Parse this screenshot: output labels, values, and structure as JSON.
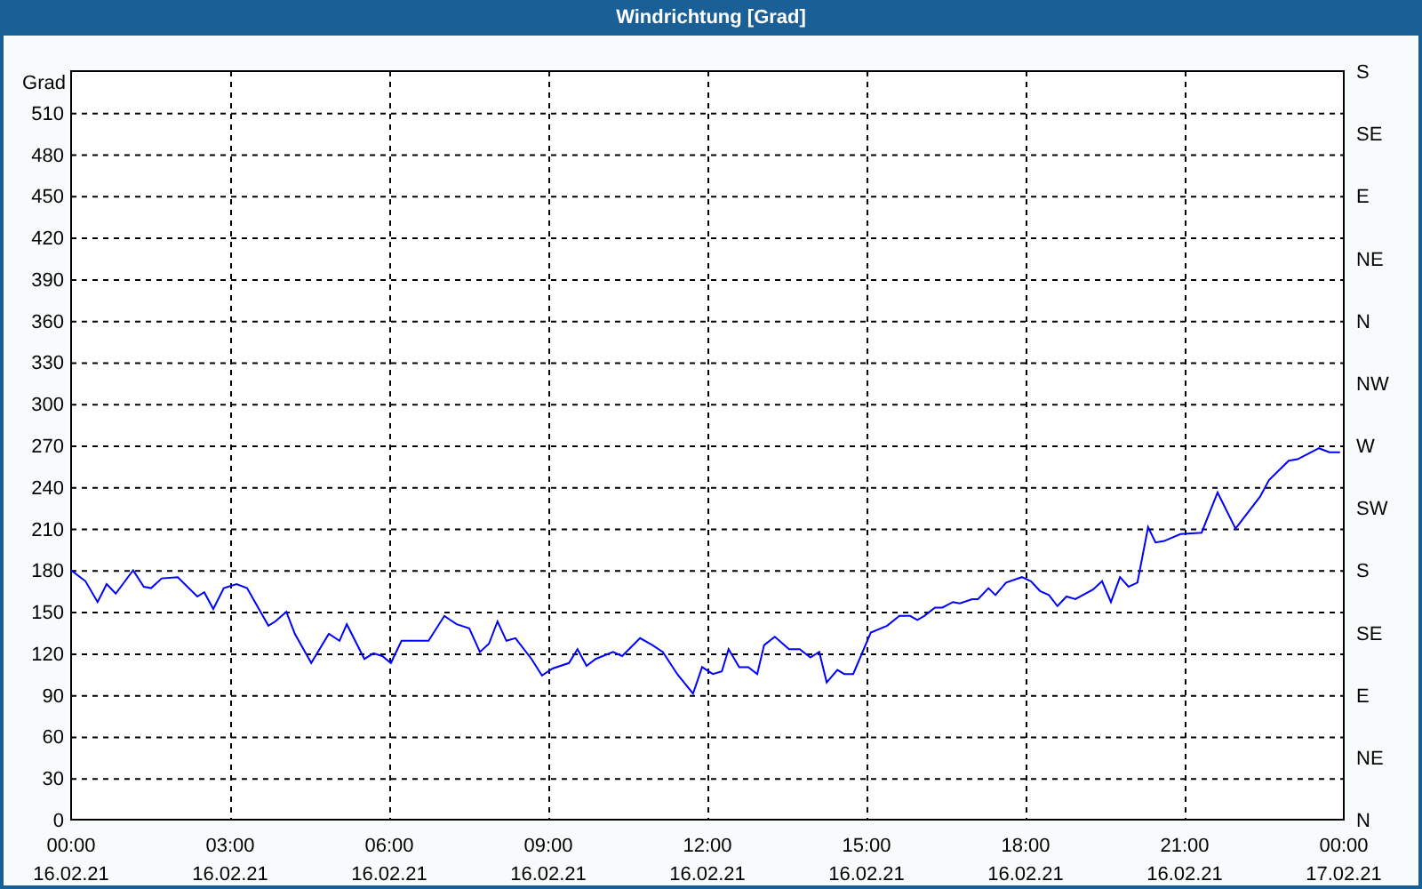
{
  "window": {
    "title": "Windrichtung [Grad]"
  },
  "chart": {
    "x_dates": [
      "16.02.21",
      "16.02.21",
      "16.02.21",
      "16.02.21",
      "16.02.21",
      "16.02.21",
      "16.02.21",
      "16.02.21",
      "17.02.21"
    ],
    "right_axis_labels": [
      "S",
      "SE",
      "E",
      "NE",
      "N",
      "NW",
      "W",
      "SW",
      "S",
      "SE",
      "E",
      "NE",
      "N"
    ],
    "chart_data": {
      "type": "line",
      "ylabel": "Grad",
      "grid": true,
      "x": [
        0,
        0.27,
        0.5,
        0.67,
        0.84,
        1.17,
        1.37,
        1.51,
        1.71,
        2.01,
        2.38,
        2.51,
        2.68,
        2.88,
        3.12,
        3.32,
        3.72,
        3.85,
        4.06,
        4.22,
        4.53,
        4.86,
        5.06,
        5.2,
        5.53,
        5.7,
        5.87,
        6.03,
        6.23,
        6.74,
        7.04,
        7.27,
        7.51,
        7.71,
        7.88,
        8.04,
        8.21,
        8.38,
        8.68,
        8.88,
        9.08,
        9.39,
        9.55,
        9.72,
        9.89,
        10.22,
        10.39,
        10.73,
        10.96,
        11.16,
        11.43,
        11.73,
        11.9,
        12.1,
        12.27,
        12.4,
        12.6,
        12.77,
        12.94,
        13.07,
        13.27,
        13.54,
        13.74,
        13.94,
        14.11,
        14.25,
        14.45,
        14.58,
        14.75,
        15.08,
        15.39,
        15.62,
        15.82,
        15.96,
        16.09,
        16.29,
        16.43,
        16.63,
        16.76,
        16.99,
        17.1,
        17.3,
        17.43,
        17.63,
        17.93,
        18.1,
        18.27,
        18.44,
        18.6,
        18.77,
        18.94,
        19.27,
        19.44,
        19.61,
        19.78,
        19.94,
        20.11,
        20.31,
        20.45,
        20.61,
        20.92,
        21.32,
        21.62,
        21.96,
        22.42,
        22.59,
        22.96,
        23.13,
        23.53,
        23.73,
        23.93
      ],
      "series": [
        {
          "color": "#0000ff",
          "values": [
            180,
            172,
            157,
            170,
            163,
            180,
            168,
            167,
            174,
            175,
            161,
            164,
            152,
            167,
            170,
            167,
            140,
            143,
            150,
            134,
            113,
            134,
            129,
            141,
            116,
            120,
            118,
            113,
            129,
            129,
            147,
            141,
            138,
            121,
            127,
            143,
            129,
            131,
            116,
            104,
            109,
            113,
            123,
            111,
            116,
            121,
            118,
            131,
            126,
            121,
            105,
            91,
            110,
            105,
            107,
            123,
            110,
            110,
            105,
            126,
            132,
            123,
            123,
            117,
            121,
            99,
            108,
            105,
            105,
            135,
            140,
            147,
            147,
            144,
            147,
            153,
            153,
            157,
            156,
            159,
            159,
            167,
            162,
            171,
            175,
            172,
            165,
            162,
            154,
            161,
            159,
            166,
            172,
            157,
            175,
            168,
            171,
            211,
            200,
            201,
            206,
            207,
            236,
            210,
            233,
            245,
            259,
            260,
            268,
            265,
            265
          ]
        }
      ],
      "xlim": [
        0,
        24
      ],
      "ylim": [
        0,
        540
      ],
      "xticks": [
        {
          "value": 0,
          "label": "00:00"
        },
        {
          "value": 3,
          "label": "03:00"
        },
        {
          "value": 6,
          "label": "06:00"
        },
        {
          "value": 9,
          "label": "09:00"
        },
        {
          "value": 12,
          "label": "12:00"
        },
        {
          "value": 15,
          "label": "15:00"
        },
        {
          "value": 18,
          "label": "18:00"
        },
        {
          "value": 21,
          "label": "21:00"
        },
        {
          "value": 24,
          "label": "00:00"
        }
      ],
      "yticks": [
        0,
        30,
        60,
        90,
        120,
        150,
        180,
        210,
        240,
        270,
        300,
        330,
        360,
        390,
        420,
        450,
        480,
        510
      ]
    }
  }
}
